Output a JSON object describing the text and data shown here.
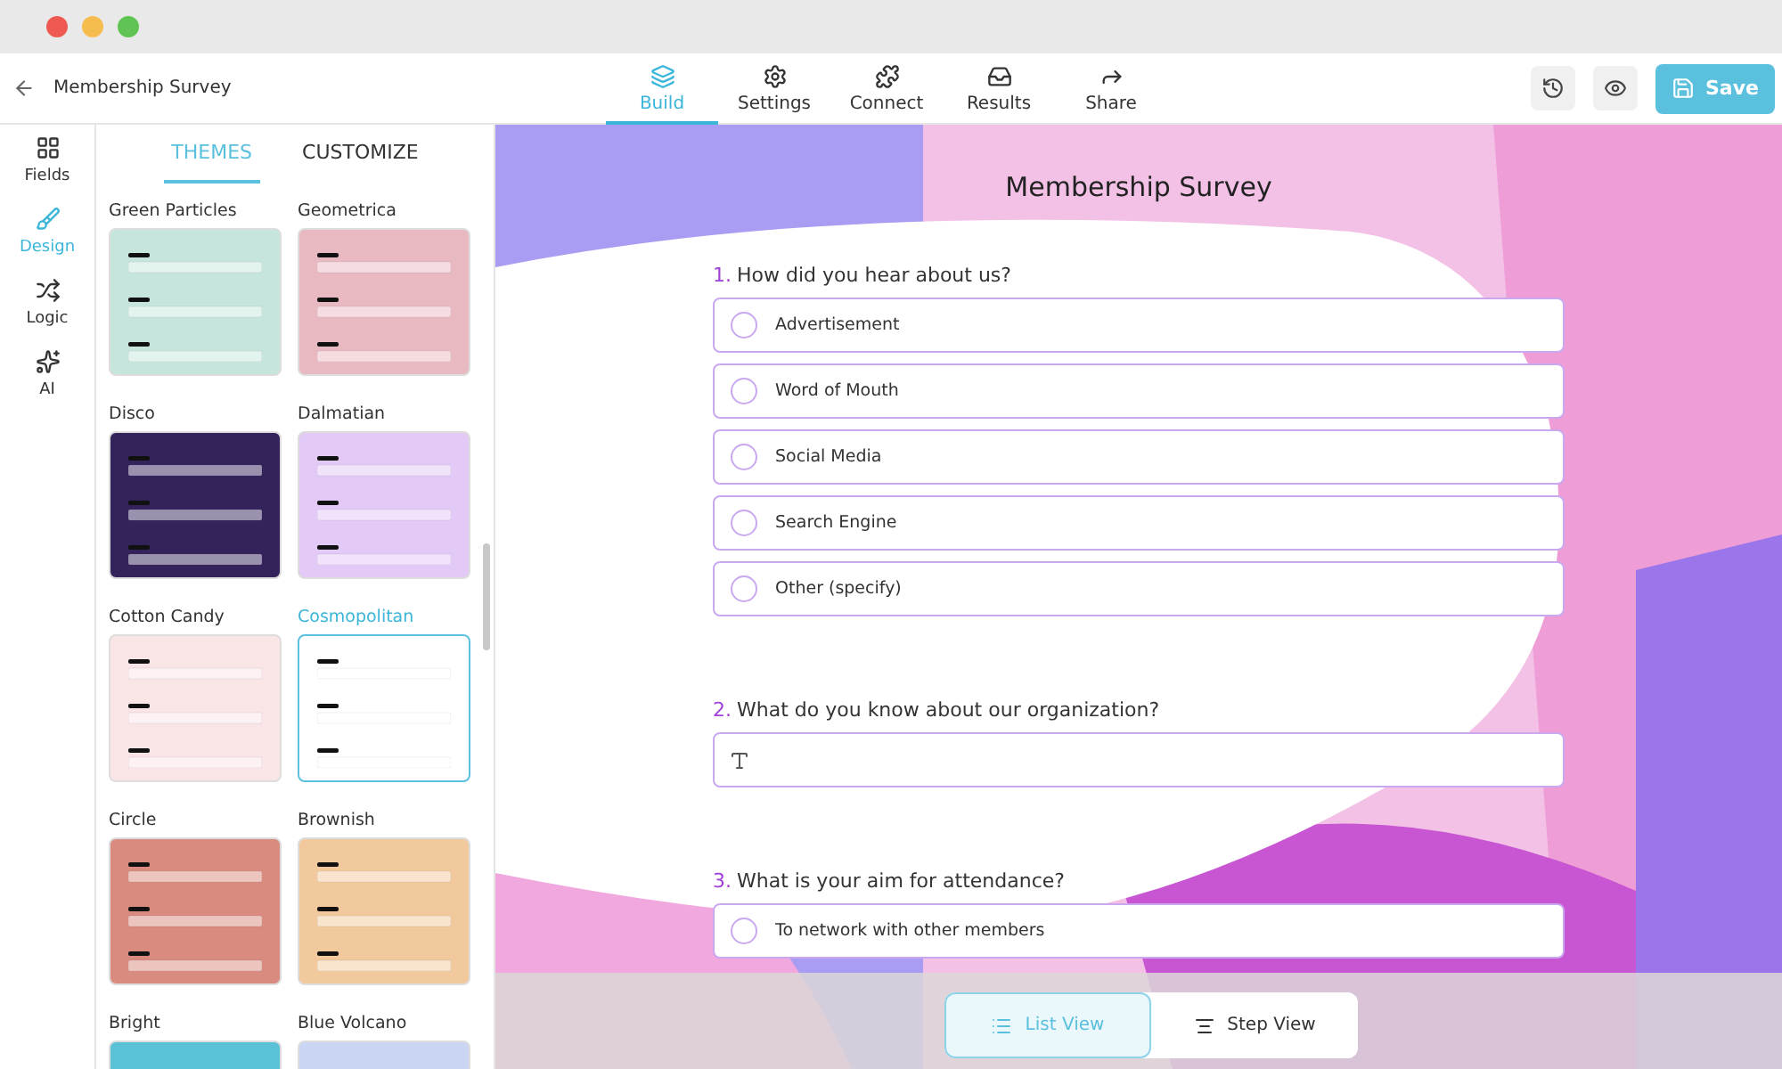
{
  "header": {
    "title": "Membership Survey"
  },
  "nav_tabs": [
    {
      "label": "Build",
      "selected": true
    },
    {
      "label": "Settings",
      "selected": false
    },
    {
      "label": "Connect",
      "selected": false
    },
    {
      "label": "Results",
      "selected": false
    },
    {
      "label": "Share",
      "selected": false
    }
  ],
  "save_button": "Save",
  "rail": [
    {
      "label": "Fields",
      "selected": false
    },
    {
      "label": "Design",
      "selected": true
    },
    {
      "label": "Logic",
      "selected": false
    },
    {
      "label": "AI",
      "selected": false
    }
  ],
  "panel_tabs": [
    {
      "label": "THEMES",
      "selected": true
    },
    {
      "label": "CUSTOMIZE",
      "selected": false
    }
  ],
  "themes": [
    {
      "name": "Green Particles",
      "color": "#c6e6dd",
      "selected": false
    },
    {
      "name": "Geometrica",
      "color": "#e9b9c1",
      "selected": false
    },
    {
      "name": "Disco",
      "color": "#33235a",
      "selected": false
    },
    {
      "name": "Dalmatian",
      "color": "#e3c9f5",
      "selected": false
    },
    {
      "name": "Cotton Candy",
      "color": "#f9e5e6",
      "selected": false
    },
    {
      "name": "Cosmopolitan",
      "color": "#ffffff",
      "selected": true
    },
    {
      "name": "Circle",
      "color": "#d88b7e",
      "selected": false
    },
    {
      "name": "Brownish",
      "color": "#f2c99c",
      "selected": false
    },
    {
      "name": "Bright",
      "color": "#5bc1d6",
      "selected": false
    },
    {
      "name": "Blue Volcano",
      "color": "#c9d5f2",
      "selected": false
    }
  ],
  "form": {
    "title": "Membership Survey",
    "questions": [
      {
        "number": "1.",
        "text": "How did you hear about us?",
        "kind": "choice",
        "options": [
          "Advertisement",
          "Word of Mouth",
          "Social Media",
          "Search Engine",
          "Other (specify)"
        ]
      },
      {
        "number": "2.",
        "text": "What do you know about our organization?",
        "kind": "text"
      },
      {
        "number": "3.",
        "text": "What is your aim for attendance?",
        "kind": "choice",
        "options": [
          "To network with other members"
        ]
      }
    ]
  },
  "view_toggle": [
    {
      "label": "List View",
      "selected": true
    },
    {
      "label": "Step View",
      "selected": false
    }
  ]
}
